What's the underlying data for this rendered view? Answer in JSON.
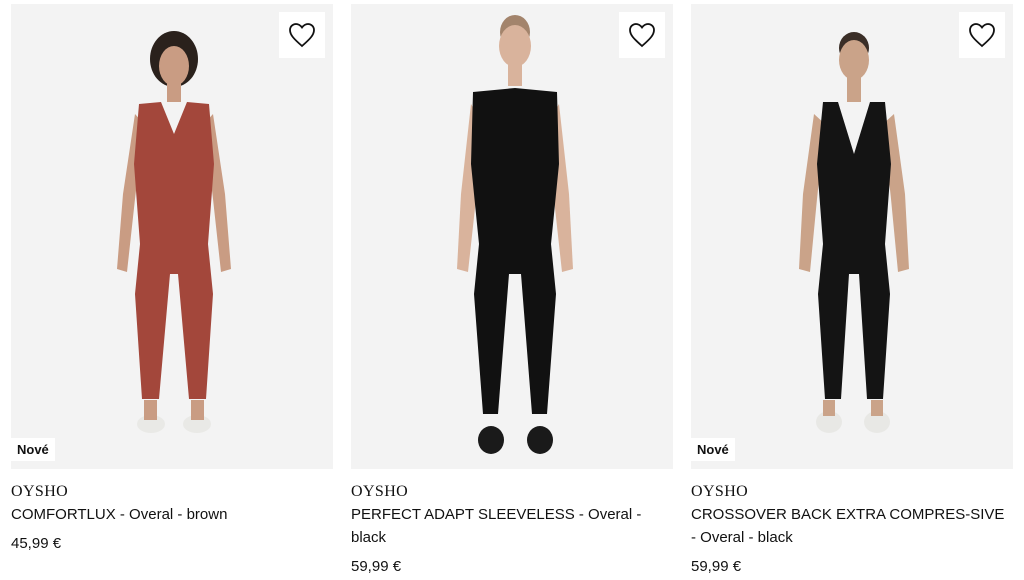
{
  "products": [
    {
      "brand": "OYSHO",
      "name": "COMFORTLUX - Overal - brown",
      "price": "45,99 €",
      "badge": "Nové",
      "color": "#a3473b"
    },
    {
      "brand": "OYSHO",
      "name": "PERFECT ADAPT SLEEVELESS - Overal - black",
      "price": "59,99 €",
      "badge": "",
      "color": "#111111"
    },
    {
      "brand": "OYSHO",
      "name": "CROSSOVER BACK EXTRA COMPRES-SIVE - Overal - black",
      "price": "59,99 €",
      "badge": "Nové",
      "color": "#141414"
    }
  ],
  "icons": {
    "favorite": "heart-outline-icon"
  }
}
